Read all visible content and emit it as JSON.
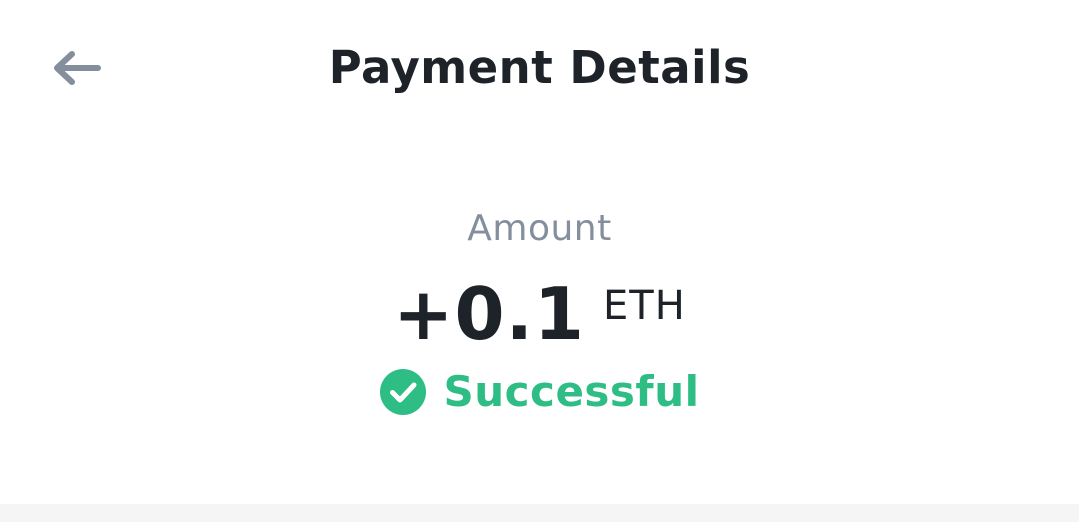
{
  "header": {
    "back_icon": "arrow-left-icon",
    "title": "Payment Details"
  },
  "summary": {
    "amount_label": "Amount",
    "amount_value": "+0.1",
    "currency": "ETH",
    "status": {
      "icon": "check-circle-icon",
      "label": "Successful"
    }
  },
  "colors": {
    "title_text": "#1e2329",
    "label_text": "#848e9c",
    "back_icon": "#848e9c",
    "success": "#2ebd85",
    "bottom_band": "#f5f5f5"
  }
}
